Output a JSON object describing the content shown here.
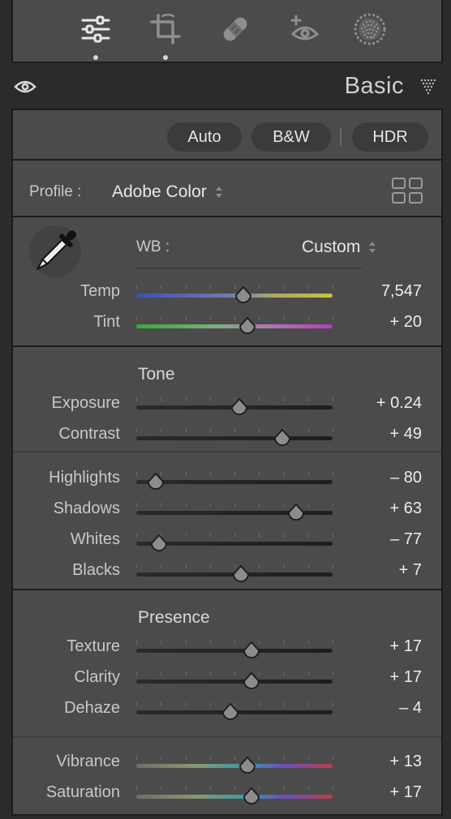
{
  "toolstrip": {
    "tools": [
      {
        "name": "edit-sliders-icon",
        "active": true,
        "has_dot": true
      },
      {
        "name": "crop-icon",
        "active": false,
        "has_dot": true
      },
      {
        "name": "healing-bandage-icon",
        "active": false,
        "has_dot": false
      },
      {
        "name": "red-eye-icon",
        "active": false,
        "has_dot": false
      },
      {
        "name": "masking-icon",
        "active": false,
        "has_dot": false
      }
    ]
  },
  "header": {
    "title": "Basic"
  },
  "buttons": {
    "auto": "Auto",
    "bw": "B&W",
    "hdr": "HDR"
  },
  "profile": {
    "label": "Profile :",
    "value": "Adobe Color"
  },
  "wb": {
    "label": "WB :",
    "value": "Custom"
  },
  "wb_sliders": [
    {
      "label": "Temp",
      "value": "7,547",
      "position": 0.545,
      "gradient": "temp"
    },
    {
      "label": "Tint",
      "value": "+ 20",
      "position": 0.565,
      "gradient": "tint"
    }
  ],
  "tone": {
    "title": "Tone",
    "sliders_a": [
      {
        "label": "Exposure",
        "value": "+ 0.24",
        "position": 0.524
      },
      {
        "label": "Contrast",
        "value": "+ 49",
        "position": 0.745
      }
    ],
    "sliders_b": [
      {
        "label": "Highlights",
        "value": "– 80",
        "position": 0.1
      },
      {
        "label": "Shadows",
        "value": "+ 63",
        "position": 0.815
      },
      {
        "label": "Whites",
        "value": "– 77",
        "position": 0.115
      },
      {
        "label": "Blacks",
        "value": "+ 7",
        "position": 0.535
      }
    ]
  },
  "presence": {
    "title": "Presence",
    "sliders_a": [
      {
        "label": "Texture",
        "value": "+ 17",
        "position": 0.585
      },
      {
        "label": "Clarity",
        "value": "+ 17",
        "position": 0.585
      },
      {
        "label": "Dehaze",
        "value": "– 4",
        "position": 0.48
      }
    ],
    "sliders_b": [
      {
        "label": "Vibrance",
        "value": "+ 13",
        "position": 0.565,
        "gradient": "color"
      },
      {
        "label": "Saturation",
        "value": "+ 17",
        "position": 0.585,
        "gradient": "color"
      }
    ]
  },
  "colors": {
    "panel_bg": "#4b4b4b",
    "header_bg": "#2b2b2b",
    "pill_bg": "#3b3b3b"
  }
}
